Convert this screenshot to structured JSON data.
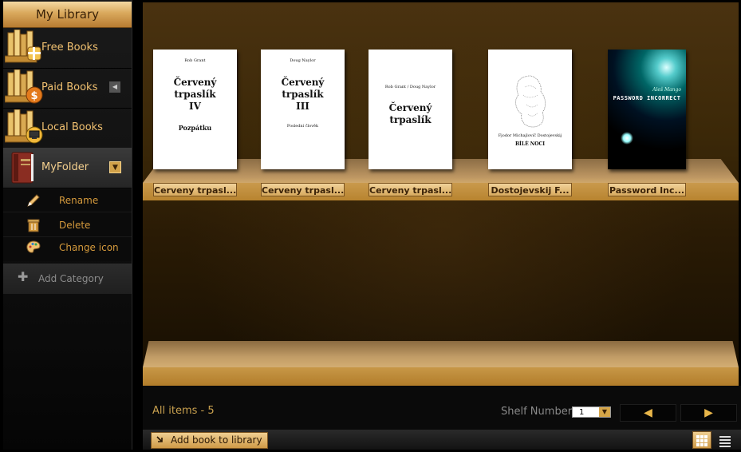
{
  "sidebar": {
    "title": "My Library",
    "categories": [
      {
        "label": "Free Books",
        "icon": "free-books-icon"
      },
      {
        "label": "Paid Books",
        "icon": "paid-books-icon"
      },
      {
        "label": "Local Books",
        "icon": "local-books-icon"
      },
      {
        "label": "MyFolder",
        "icon": "folder-book-icon"
      }
    ],
    "folder_actions": [
      {
        "label": "Rename",
        "icon": "pencil-icon"
      },
      {
        "label": "Delete",
        "icon": "trash-icon"
      },
      {
        "label": "Change icon",
        "icon": "palette-icon"
      }
    ],
    "add_category": "Add Category"
  },
  "shelf": {
    "books": [
      {
        "label": "Cerveny trpasl...",
        "author": "Rob Grant",
        "title_lines": [
          "Červený",
          "trpaslík",
          "IV"
        ],
        "subtitle": "Pozpátku"
      },
      {
        "label": "Cerveny trpasl...",
        "author": "Doug Naylor",
        "title_lines": [
          "Červený",
          "trpaslík",
          "III"
        ],
        "subtitle": "Poslední člověk"
      },
      {
        "label": "Cerveny trpasl...",
        "author": "Rob Grant / Doug Naylor",
        "title_lines": [
          "Červený",
          "trpaslík"
        ],
        "subtitle": ""
      },
      {
        "label": "Dostojevskij F...",
        "author": "Fjodor Michajlovič Dostojevskij",
        "title_lines": [
          "BÍLÉ NOCI"
        ],
        "subtitle": ""
      },
      {
        "label": "Password Inc...",
        "author": "Aleš Mango",
        "title_lines": [
          "PASSWORD INCORRECT"
        ],
        "subtitle": ""
      }
    ]
  },
  "footer": {
    "all_items": "All items - 5",
    "shelf_number_label": "Shelf Number",
    "shelf_number_value": "1",
    "prev_label": "◀",
    "next_label": "▶",
    "add_book_label": "Add book to library"
  },
  "colors": {
    "accent_gold": "#d8aa5e",
    "label_orange": "#f0c070",
    "shelf_wood": "#b8842f"
  }
}
